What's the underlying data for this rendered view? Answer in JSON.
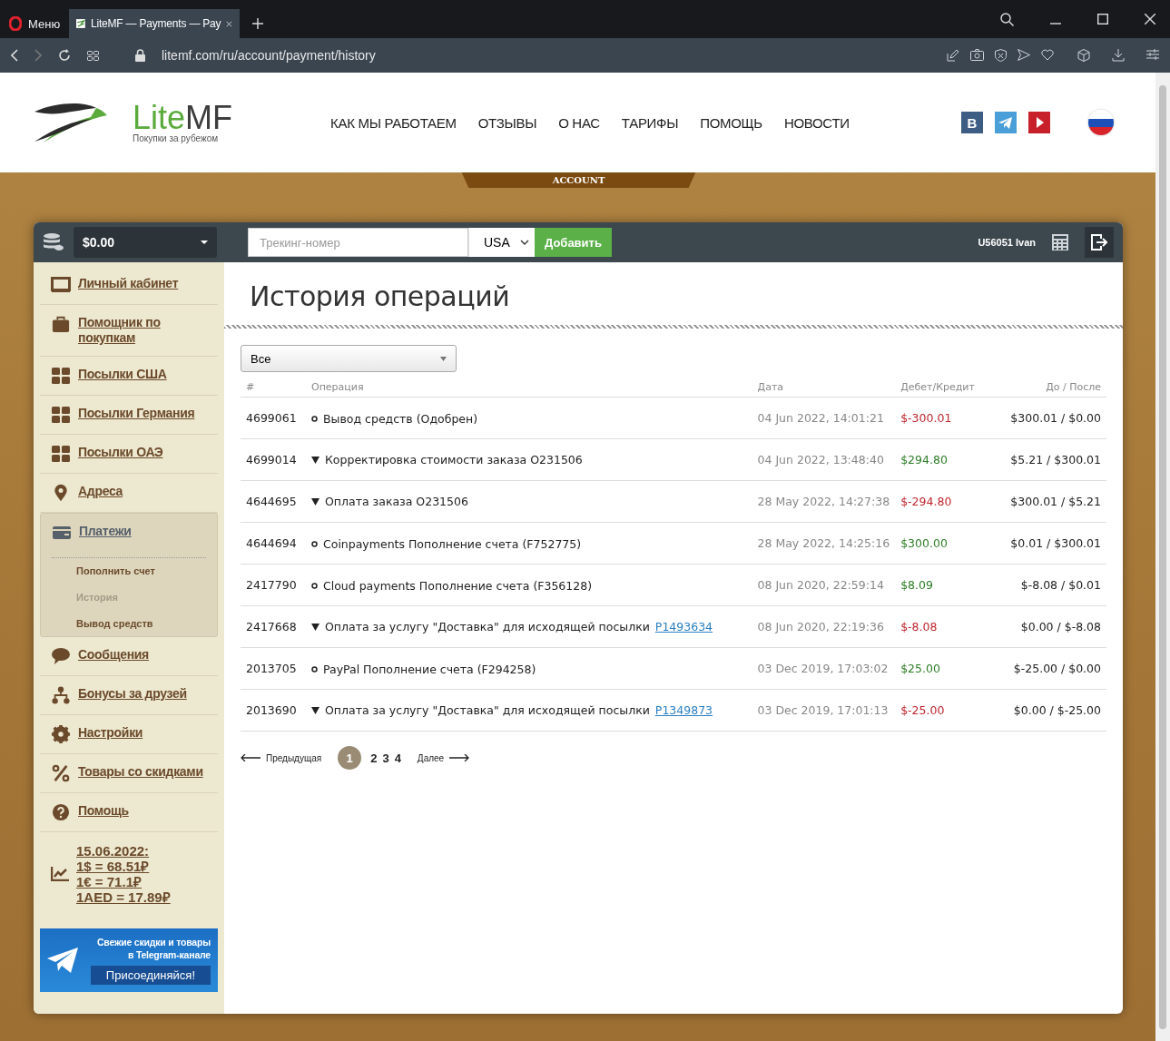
{
  "browser": {
    "menu_label": "Меню",
    "tab_title": "LiteMF — Payments — Pay",
    "url": "litemf.com/ru/account/payment/history"
  },
  "header": {
    "logo": {
      "part_1": "Lite",
      "part_2": "MF",
      "tagline": "Покупки за рубежом"
    },
    "nav": [
      "КАК МЫ РАБОТАЕМ",
      "ОТЗЫВЫ",
      "О НАС",
      "ТАРИФЫ",
      "ПОМОЩЬ",
      "НОВОСТИ"
    ],
    "social": [
      {
        "kind": "vk",
        "label": "В"
      },
      {
        "kind": "telegram"
      },
      {
        "kind": "youtube"
      }
    ],
    "ribbon": "ACCOUNT"
  },
  "topbar": {
    "balance": "$0.00",
    "tracking_placeholder": "Трекинг-номер",
    "country": "USA",
    "add_button": "Добавить",
    "user": "U56051 Ivan"
  },
  "sidebar": {
    "items": [
      {
        "kind": "monitor",
        "label": "Личный кабинет",
        "selected": false
      },
      {
        "kind": "bag",
        "label": "Помощник по покупкам",
        "selected": false
      },
      {
        "kind": "grid",
        "label": "Посылки США",
        "selected": false
      },
      {
        "kind": "grid",
        "label": "Посылки Германия",
        "selected": false
      },
      {
        "kind": "grid",
        "label": "Посылки ОАЭ",
        "selected": false
      },
      {
        "kind": "pin",
        "label": "Адреса",
        "selected": false
      },
      {
        "kind": "card",
        "label": "Платежи",
        "selected": true,
        "expanded": true,
        "children": [
          {
            "label": "Пополнить счет",
            "selected": false
          },
          {
            "label": "История",
            "selected": true
          },
          {
            "label": "Вывод средств",
            "selected": false
          }
        ]
      },
      {
        "kind": "chat",
        "label": "Сообщения",
        "selected": false
      },
      {
        "kind": "tree",
        "label": "Бонусы за друзей",
        "selected": false
      },
      {
        "kind": "gear",
        "label": "Настройки",
        "selected": false
      },
      {
        "kind": "percent",
        "label": "Товары со скидками",
        "selected": false
      },
      {
        "kind": "help",
        "label": "Помощь",
        "selected": false
      }
    ],
    "rates": [
      "15.06.2022:",
      "1$ = 68.51₽",
      "1€ = 71.1₽",
      "1AED = 17.89₽"
    ],
    "promo": {
      "text_1": "Свежие скидки и товары",
      "text_2": "в Telegram-канале",
      "button": "Присоединяйся!"
    }
  },
  "main": {
    "title": "История операций",
    "filter": "Все",
    "table": {
      "columns": [
        "#",
        "Операция",
        "Дата",
        "Дебет/Кредит",
        "До / После"
      ],
      "rows": [
        {
          "id": "4699061",
          "kind": "ring",
          "operation": "Вывод средств (Одобрен)",
          "date": "04 Jun 2022, 14:01:21",
          "amount": "$-300.01",
          "color": "#c0262d",
          "balance": "$300.01 / $0.00"
        },
        {
          "id": "4699014",
          "kind": "triangle",
          "operation": "Корректировка стоимости заказа O231506",
          "date": "04 Jun 2022, 13:48:40",
          "amount": "$294.80",
          "color": "#2e7d27",
          "balance": "$5.21 / $300.01"
        },
        {
          "id": "4644695",
          "kind": "triangle",
          "operation": "Оплата заказа O231506",
          "date": "28 May 2022, 14:27:38",
          "amount": "$-294.80",
          "color": "#c0262d",
          "balance": "$300.01 / $5.21"
        },
        {
          "id": "4644694",
          "kind": "ring",
          "operation": "Coinpayments Пополнение счета (F752775)",
          "date": "28 May 2022, 14:25:16",
          "amount": "$300.00",
          "color": "#2e7d27",
          "balance": "$0.01 / $300.01"
        },
        {
          "id": "2417790",
          "kind": "ring",
          "operation": "Cloud payments Пополнение счета (F356128)",
          "date": "08 Jun 2020, 22:59:14",
          "amount": "$8.09",
          "color": "#2e7d27",
          "balance": "$-8.08 / $0.01"
        },
        {
          "id": "2417668",
          "kind": "triangle",
          "operation": "Оплата за услугу \"Доставка\" для исходящей посылки",
          "link": "P1493634",
          "date": "08 Jun 2020, 22:19:36",
          "amount": "$-8.08",
          "color": "#c0262d",
          "balance": "$0.00 / $-8.08"
        },
        {
          "id": "2013705",
          "kind": "ring",
          "operation": "PayPal Пополнение счета (F294258)",
          "date": "03 Dec 2019, 17:03:02",
          "amount": "$25.00",
          "color": "#2e7d27",
          "balance": "$-25.00 / $0.00"
        },
        {
          "id": "2013690",
          "kind": "triangle",
          "operation": "Оплата за услугу \"Доставка\" для исходящей посылки",
          "link": "P1349873",
          "date": "03 Dec 2019, 17:01:13",
          "amount": "$-25.00",
          "color": "#c0262d",
          "balance": "$0.00 / $-25.00"
        }
      ]
    },
    "pagination": {
      "previous": "Предыдущая",
      "pages": [
        {
          "label": "1",
          "selected": true
        },
        {
          "label": "2",
          "selected": false
        },
        {
          "label": "3",
          "selected": false
        },
        {
          "label": "4",
          "selected": false
        }
      ],
      "next": "Далее"
    }
  }
}
